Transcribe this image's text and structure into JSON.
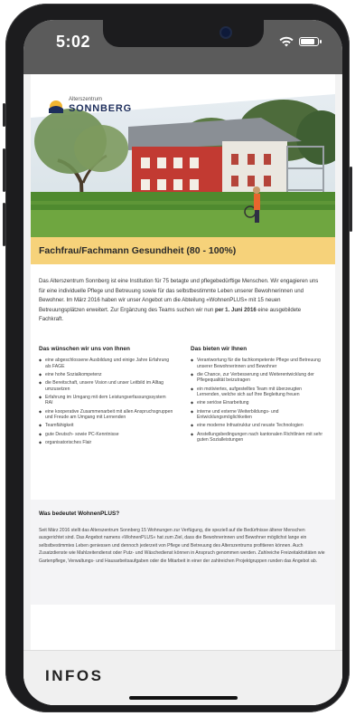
{
  "status_bar": {
    "time": "5:02",
    "icons": [
      "wifi-icon",
      "battery-icon"
    ]
  },
  "logo": {
    "small": "Alterszentrum",
    "big": "SONNBERG"
  },
  "job": {
    "title": "Fachfrau/Fachmann Gesundheit (80 - 100%)"
  },
  "intro": {
    "text": "Das Alterszentrum Sonnberg ist eine Institution für 75 betagte und pflegebedürftige Menschen. Wir engagieren uns für eine individuelle Pflege und Betreuung sowie für das selbstbestimmte Leben unserer Bewohnerinnen und Bewohner. Im März 2016 haben wir unser Angebot um die Abteilung «WohnenPLUS» mit 15 neuen Betreuungsplätzen erweitert. Zur Ergänzung des Teams suchen wir nun ",
    "bold": "per 1. Juni 2016",
    "tail": " eine ausgebildete Fachkraft."
  },
  "wishes": {
    "heading": "Das wünschen wir uns von Ihnen",
    "items": [
      "eine abgeschlossene Ausbildung und einige Jahre Erfahrung als FAGE",
      "eine hohe Sozialkompetenz",
      "die Bereitschaft, unsere Vision und unser Leitbild im Alltag umzusetzen",
      "Erfahrung im Umgang mit dem Leistungserfassungssystem RAI",
      "eine kooperative Zusammenarbeit mit allen Anspruchsgruppen und Freude am Umgang mit Lernenden",
      "Teamfähigkeit",
      "gute Deutsch- sowie PC-Kenntnisse",
      "organisatorisches Flair"
    ]
  },
  "offers": {
    "heading": "Das bieten wir Ihnen",
    "items": [
      "Verantwortung für die fachkompetente Pflege und Betreuung unserer Bewohnerinnen und Bewohner",
      "die Chance, zur Verbesserung und Weiterentwicklung der Pflegequalität beizutragen",
      "ein motiviertes, aufgestelltes Team mit überzeugten Lernenden, welche sich auf Ihre Begleitung freuen",
      "eine seriöse Einarbeitung",
      "interne und externe Weiterbildungs- und Entwicklungsmöglichkeiten",
      "eine moderne Infrastruktur und neuste Technologien",
      "Anstellungsbedingungen nach kantonalen Richtlinien mit sehr guten Sozialleistungen"
    ]
  },
  "wohnenplus": {
    "heading": "Was bedeutet WohnenPLUS?",
    "text": "Seit März 2016 stellt das Alterszentrum Sonnberg 15 Wohnungen zur Verfügung, die speziell auf die Bedürfnisse älterer Menschen ausgerichtet sind. Das Angebot namens «WohnenPLUS» hat zum Ziel, dass die Bewohnerinnen und Bewohner möglichst lange ein selbstbestimmtes Leben geniessen und dennoch jederzeit von Pflege und Betreuung des Alterszentrums profitieren können. Auch Zusatzdienste wie Mahlzeitendienst oder Putz- und Wäschedienst können in Anspruch genommen werden. Zahlreiche Freizeitaktivitäten wie Gartenpflege, Verwaltungs- und Hausarbeitsaufgaben oder die Mitarbeit in einer der zahlreichen Projektgruppen runden das Angebot ab."
  },
  "infos": {
    "label": "INFOS"
  }
}
